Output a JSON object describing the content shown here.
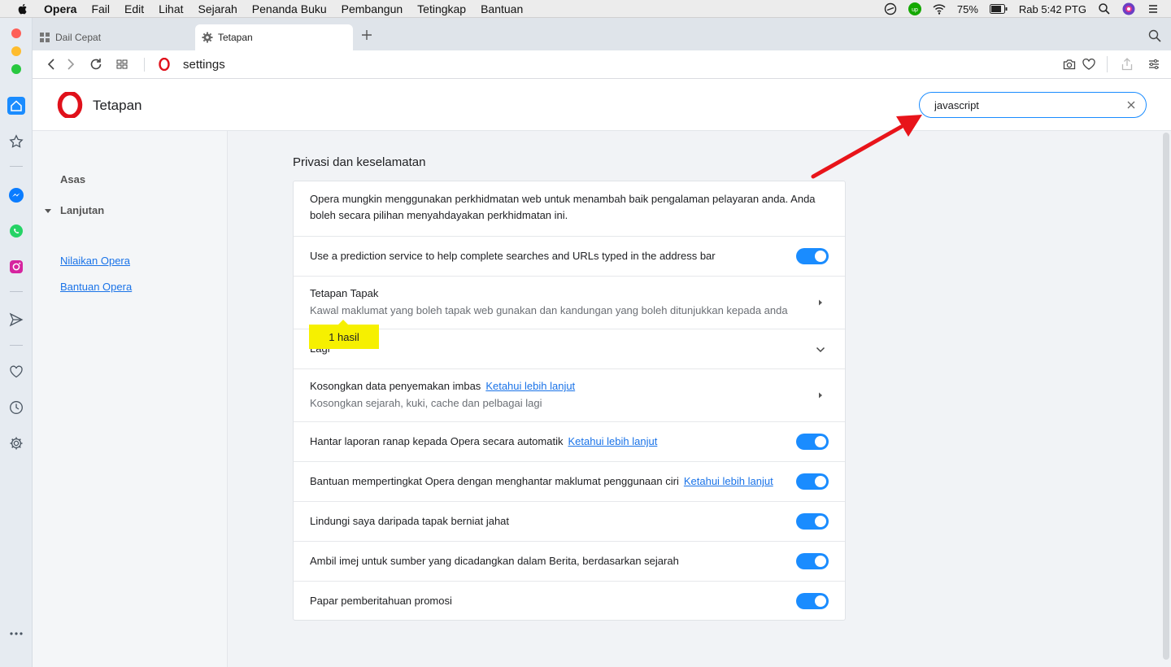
{
  "menubar": {
    "items": [
      "Opera",
      "Fail",
      "Edit",
      "Lihat",
      "Sejarah",
      "Penanda Buku",
      "Pembangun",
      "Tetingkap",
      "Bantuan"
    ],
    "battery": "75%",
    "clock": "Rab 5:42 PTG"
  },
  "tabs": [
    {
      "label": "Dail Cepat"
    },
    {
      "label": "Tetapan"
    }
  ],
  "address": {
    "url": "settings"
  },
  "header": {
    "title": "Tetapan"
  },
  "search": {
    "value": "javascript",
    "placeholder": ""
  },
  "nav": {
    "basic": "Asas",
    "advanced": "Lanjutan",
    "links": [
      "Nilaikan Opera",
      "Bantuan Opera"
    ]
  },
  "section": {
    "title": "Privasi dan keselamatan",
    "intro_line1": "Opera mungkin menggunakan perkhidmatan web untuk menambah baik pengalaman pelayaran anda. Anda",
    "intro_line2": "boleh secara pilihan menyahdayakan perkhidmatan ini.",
    "rows": [
      {
        "label": "Use a prediction service to help complete searches and URLs typed in the address bar",
        "toggle": true
      },
      {
        "label": "Tetapan Tapak",
        "sub": "Kawal maklumat yang boleh tapak web gunakan dan kandungan yang boleh ditunjukkan kepada anda"
      },
      {
        "label": "Lagi"
      },
      {
        "label": "Kosongkan data penyemakan imbas",
        "link": "Ketahui lebih lanjut",
        "sub": "Kosongkan sejarah, kuki, cache dan pelbagai lagi"
      },
      {
        "label": "Hantar laporan ranap kepada Opera secara automatik",
        "link": "Ketahui lebih lanjut",
        "toggle": true
      },
      {
        "label": "Bantuan mempertingkat Opera dengan menghantar maklumat penggunaan ciri",
        "link": "Ketahui lebih lanjut",
        "toggle": true
      },
      {
        "label": "Lindungi saya daripada tapak berniat jahat",
        "toggle": true
      },
      {
        "label": "Ambil imej untuk sumber yang dicadangkan dalam Berita, berdasarkan sejarah",
        "toggle": true
      },
      {
        "label": "Papar pemberitahuan promosi",
        "toggle": true
      }
    ]
  },
  "search_result_badge": "1 hasil",
  "colors": {
    "accent": "#1a8cff",
    "opera_red": "#e0111b",
    "highlight": "#f6f000",
    "annotation_arrow": "#e8141a"
  }
}
